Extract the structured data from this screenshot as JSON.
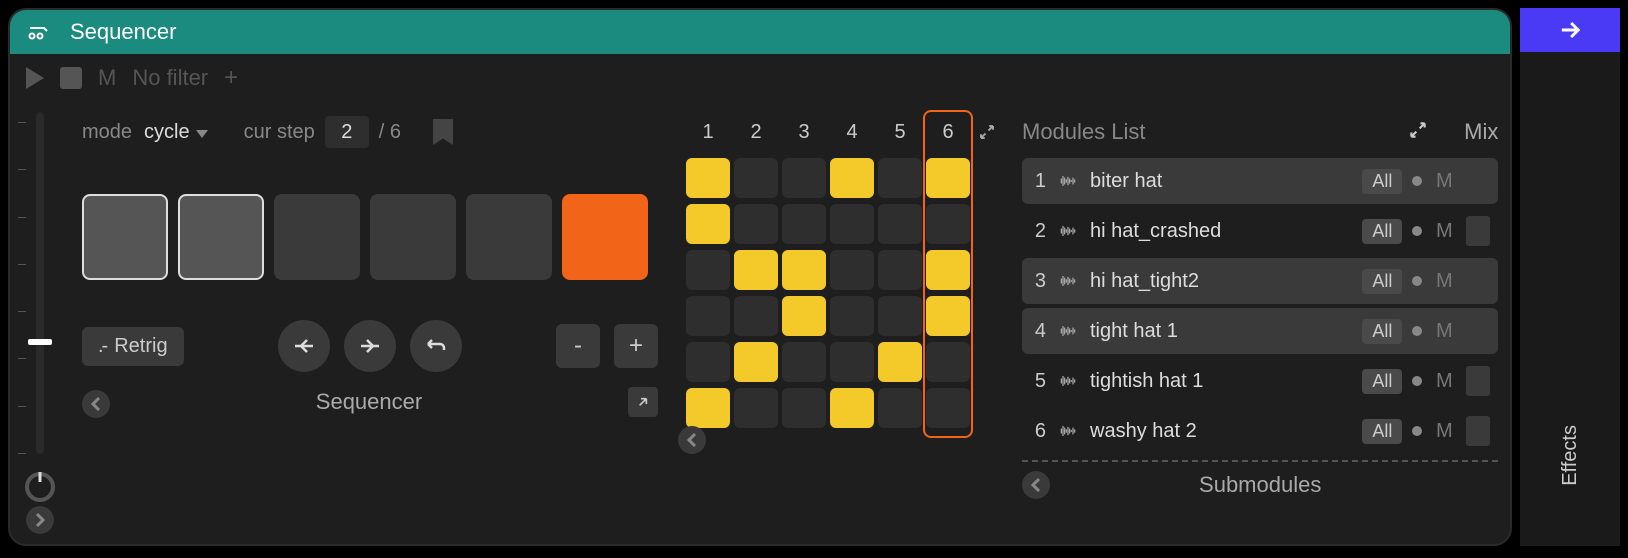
{
  "titlebar": {
    "title": "Sequencer"
  },
  "toolbar": {
    "m": "M",
    "filter": "No filter",
    "plus": "+"
  },
  "mode": {
    "label": "mode",
    "value": "cycle"
  },
  "curstep": {
    "label": "cur step",
    "value": "2",
    "total": "/ 6"
  },
  "retrig": {
    "label": "Retrig",
    "icon": ".-"
  },
  "minus": "-",
  "plus": "+",
  "left_footer": "Sequencer",
  "grid": {
    "cols": [
      "1",
      "2",
      "3",
      "4",
      "5",
      "6"
    ],
    "highlighted_col": 6,
    "rows": [
      [
        1,
        0,
        0,
        1,
        0,
        1
      ],
      [
        1,
        0,
        0,
        0,
        0,
        0
      ],
      [
        0,
        1,
        1,
        0,
        0,
        1
      ],
      [
        0,
        0,
        1,
        0,
        0,
        1
      ],
      [
        0,
        1,
        0,
        0,
        1,
        0
      ],
      [
        1,
        0,
        0,
        1,
        0,
        0
      ]
    ]
  },
  "modules": {
    "title": "Modules List",
    "mix": "Mix",
    "items": [
      {
        "n": "1",
        "name": "biter hat",
        "all": "All",
        "m": "M",
        "sel": true
      },
      {
        "n": "2",
        "name": "hi hat_crashed",
        "all": "All",
        "m": "M",
        "sel": false
      },
      {
        "n": "3",
        "name": "hi hat_tight2",
        "all": "All",
        "m": "M",
        "sel": true
      },
      {
        "n": "4",
        "name": "tight hat 1",
        "all": "All",
        "m": "M",
        "sel": true
      },
      {
        "n": "5",
        "name": "tightish hat 1",
        "all": "All",
        "m": "M",
        "sel": false
      },
      {
        "n": "6",
        "name": "washy hat 2",
        "all": "All",
        "m": "M",
        "sel": false
      }
    ]
  },
  "sub_footer": "Submodules",
  "effects": "Effects",
  "steps": [
    {
      "cls": "outlined"
    },
    {
      "cls": "outlined"
    },
    {
      "cls": "dim"
    },
    {
      "cls": "dim"
    },
    {
      "cls": "dim"
    },
    {
      "cls": "active"
    }
  ]
}
